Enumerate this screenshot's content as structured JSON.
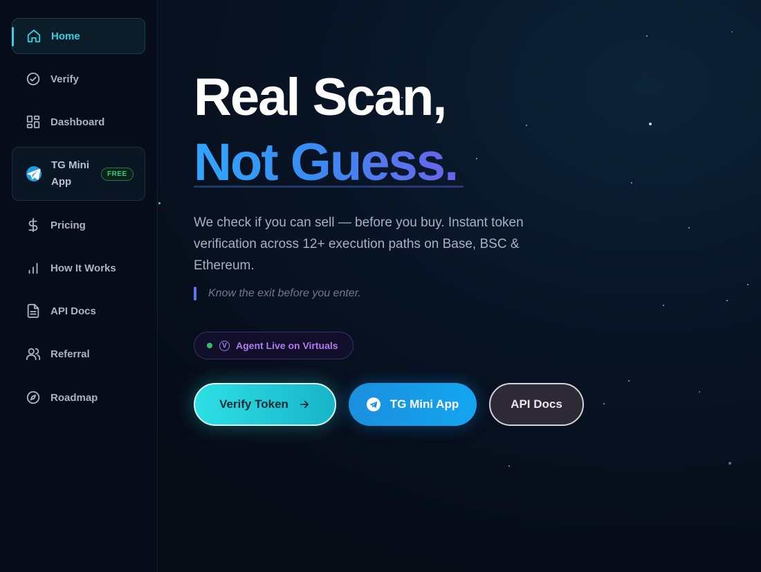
{
  "sidebar": {
    "items": [
      {
        "label": "Home",
        "icon": "home-icon",
        "active": true
      },
      {
        "label": "Verify",
        "icon": "check-circle-icon"
      },
      {
        "label": "Dashboard",
        "icon": "grid-icon"
      },
      {
        "label": "TG Mini App",
        "icon": "telegram-icon",
        "badge": "FREE"
      },
      {
        "label": "Pricing",
        "icon": "dollar-icon"
      },
      {
        "label": "How It Works",
        "icon": "bar-chart-icon"
      },
      {
        "label": "API Docs",
        "icon": "document-icon"
      },
      {
        "label": "Referral",
        "icon": "users-icon"
      },
      {
        "label": "Roadmap",
        "icon": "compass-icon"
      }
    ]
  },
  "hero": {
    "title_line1": "Real Scan,",
    "title_line2": "Not Guess.",
    "description": "We check if you can sell — before you buy. Instant token verification across 12+ execution paths on Base, BSC & Ethereum.",
    "tagline": "Know the exit before you enter.",
    "agent_badge": "Agent Live on Virtuals",
    "agent_badge_icon_letter": "V"
  },
  "buttons": {
    "verify": "Verify Token",
    "tg": "TG Mini App",
    "api": "API Docs"
  },
  "colors": {
    "accent_cyan": "#2ed3e6",
    "accent_blue": "#14a6f0",
    "accent_purple": "#b07cf0",
    "free_green": "#2ecf80",
    "background": "#060b16"
  }
}
